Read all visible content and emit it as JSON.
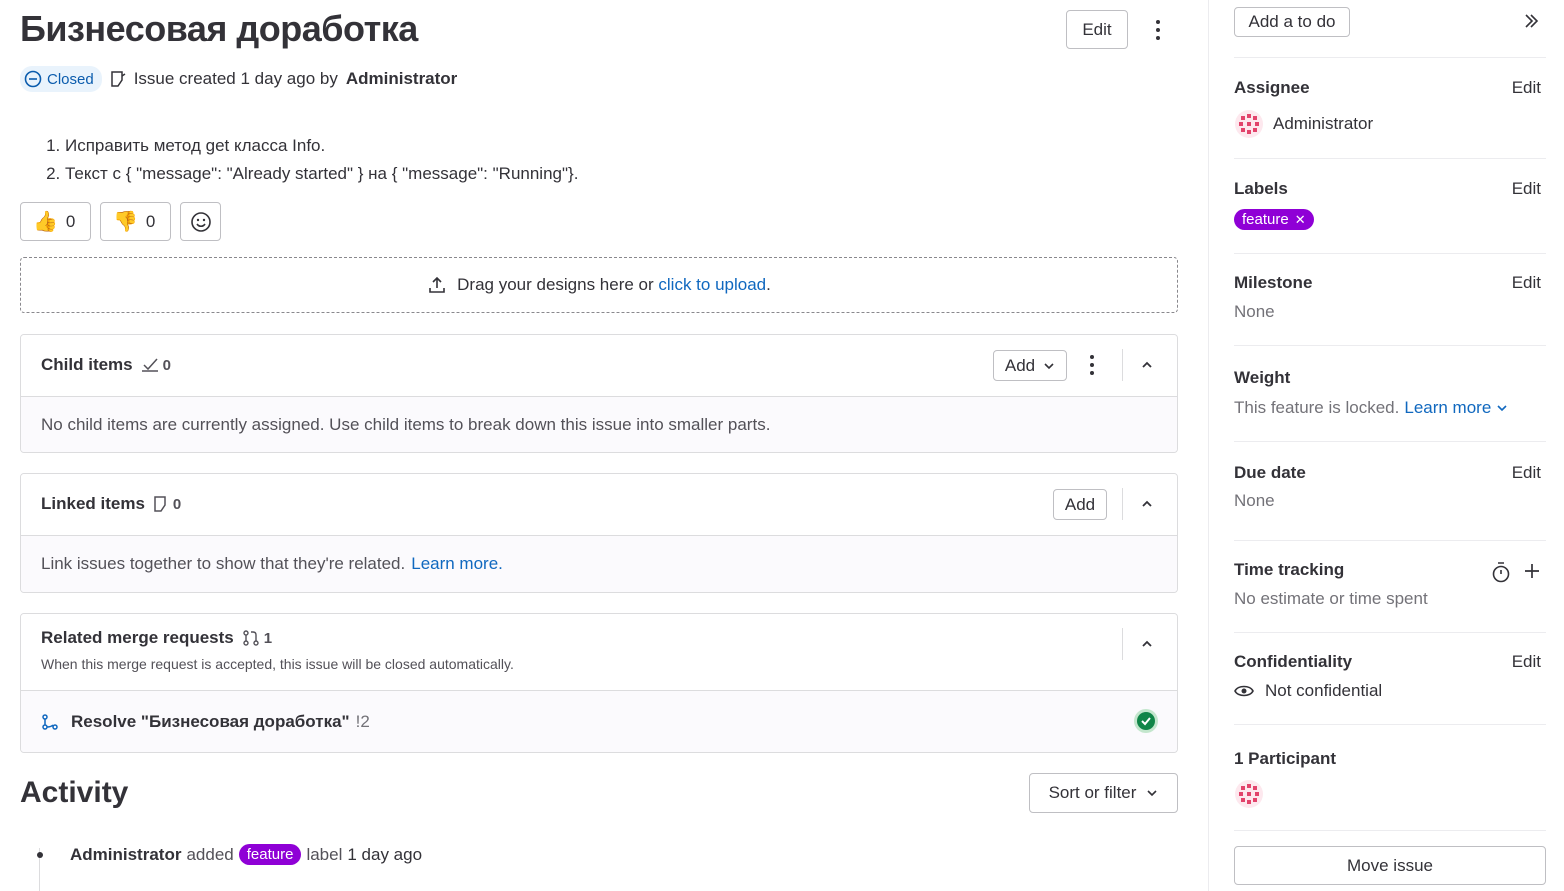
{
  "issue": {
    "title": "Бизнесовая доработка",
    "edit_label": "Edit",
    "status": "Closed",
    "created_text": "Issue created 1 day ago by",
    "author": "Administrator",
    "description": [
      "Исправить метод get класса Info.",
      "Текст с { \"message\": \"Already started\" } на { \"message\": \"Running\"}."
    ],
    "reactions": {
      "thumbs_up": "0",
      "thumbs_down": "0"
    }
  },
  "designs": {
    "text": "Drag your designs here or",
    "link": "click to upload",
    "tail": "."
  },
  "child_items": {
    "title": "Child items",
    "count": "0",
    "add_label": "Add",
    "empty_text": "No child items are currently assigned. Use child items to break down this issue into smaller parts."
  },
  "linked_items": {
    "title": "Linked items",
    "count": "0",
    "add_label": "Add",
    "empty_text": "Link issues together to show that they're related.",
    "learn_more": "Learn more."
  },
  "related_mrs": {
    "title": "Related merge requests",
    "count": "1",
    "subtitle": "When this merge request is accepted, this issue will be closed automatically.",
    "item_title": "Resolve \"Бизнесовая доработка\"",
    "item_ref": "!2"
  },
  "activity": {
    "title": "Activity",
    "sort_label": "Sort or filter",
    "entry_author": "Administrator",
    "entry_action": "added",
    "entry_label": "feature",
    "entry_tail": "label",
    "entry_time": "1 day ago"
  },
  "sidebar": {
    "add_todo": "Add a to do",
    "assignee": {
      "title": "Assignee",
      "edit": "Edit",
      "value": "Administrator"
    },
    "labels": {
      "title": "Labels",
      "edit": "Edit",
      "value": "feature",
      "color": "#8f00d6"
    },
    "milestone": {
      "title": "Milestone",
      "edit": "Edit",
      "value": "None"
    },
    "weight": {
      "title": "Weight",
      "text": "This feature is locked.",
      "learn_more": "Learn more"
    },
    "due_date": {
      "title": "Due date",
      "edit": "Edit",
      "value": "None"
    },
    "time_tracking": {
      "title": "Time tracking",
      "value": "No estimate or time spent"
    },
    "confidentiality": {
      "title": "Confidentiality",
      "edit": "Edit",
      "value": "Not confidential"
    },
    "participants": {
      "title": "1 Participant"
    },
    "move_issue": "Move issue"
  }
}
